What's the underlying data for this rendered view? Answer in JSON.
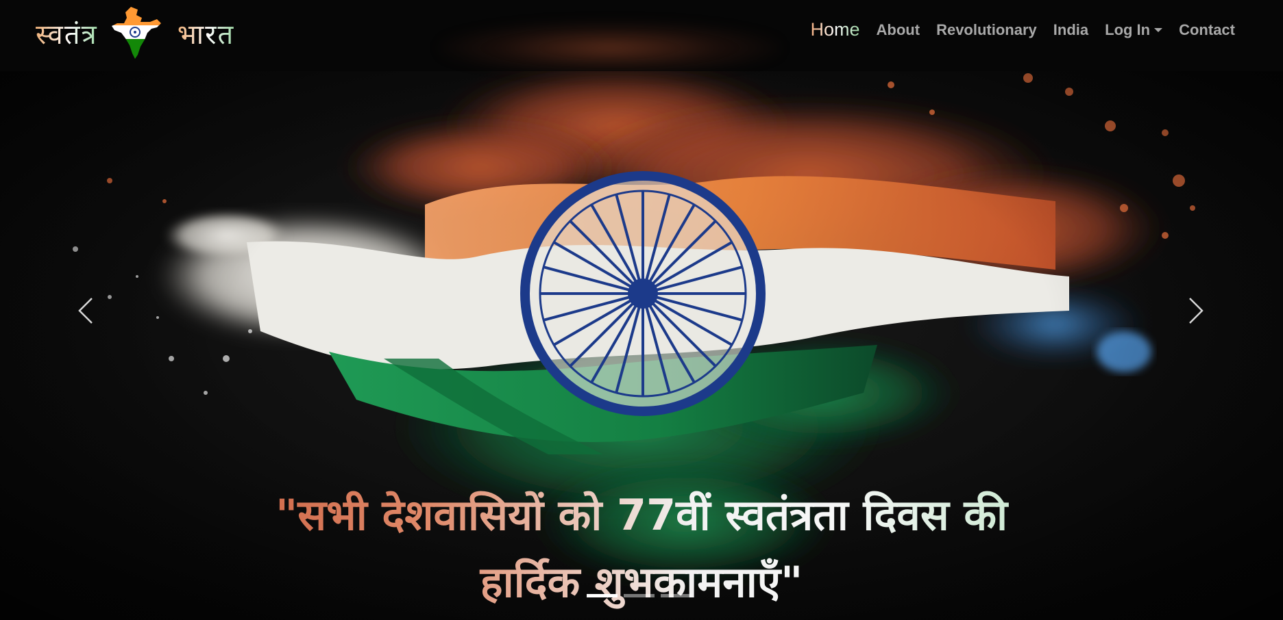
{
  "brand": {
    "left_word": "स्वतंत्र",
    "right_word": "भारत",
    "logo_icon": "india-map-logo-icon"
  },
  "nav": {
    "items": [
      {
        "label": "Home",
        "active": true
      },
      {
        "label": "About"
      },
      {
        "label": "Revolutionary"
      },
      {
        "label": "India"
      },
      {
        "label": "Log In",
        "dropdown": true
      },
      {
        "label": "Contact"
      }
    ]
  },
  "hero": {
    "image_icon": "indian-flag-powder-explosion-image",
    "caption_line1": "\"सभी देशवासियों को 77वीं स्वतंत्रता दिवस की",
    "caption_line2": "हार्दिक शुभकामनाएँ\"",
    "prev_icon": "chevron-left-icon",
    "next_icon": "chevron-right-icon",
    "slides_total": 3,
    "active_slide": 1
  },
  "colors": {
    "saffron": "#FF9933",
    "white": "#FFFFFF",
    "green": "#138808",
    "chakra_blue": "#1c3a8a",
    "navbar_bg": "#060606",
    "nav_text": "#a9a9a9"
  }
}
